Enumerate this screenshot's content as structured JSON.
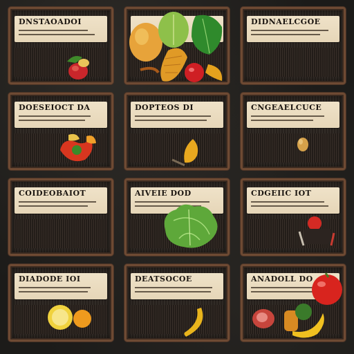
{
  "cards": [
    {
      "title": "DNSTAOADOI"
    },
    {
      "title": ""
    },
    {
      "title": "DIDNAELCGOE"
    },
    {
      "title": "DOESEIOCT DA"
    },
    {
      "title": "DOPTEOS DI"
    },
    {
      "title": "CNGEAELCUCE"
    },
    {
      "title": "COIDEOBAIOT"
    },
    {
      "title": "AIVEIE DOD"
    },
    {
      "title": "CDGEIIC IOT"
    },
    {
      "title": "DIADODE IOI"
    },
    {
      "title": "DEATSOCOE"
    },
    {
      "title": "ANADOLL DO"
    }
  ]
}
